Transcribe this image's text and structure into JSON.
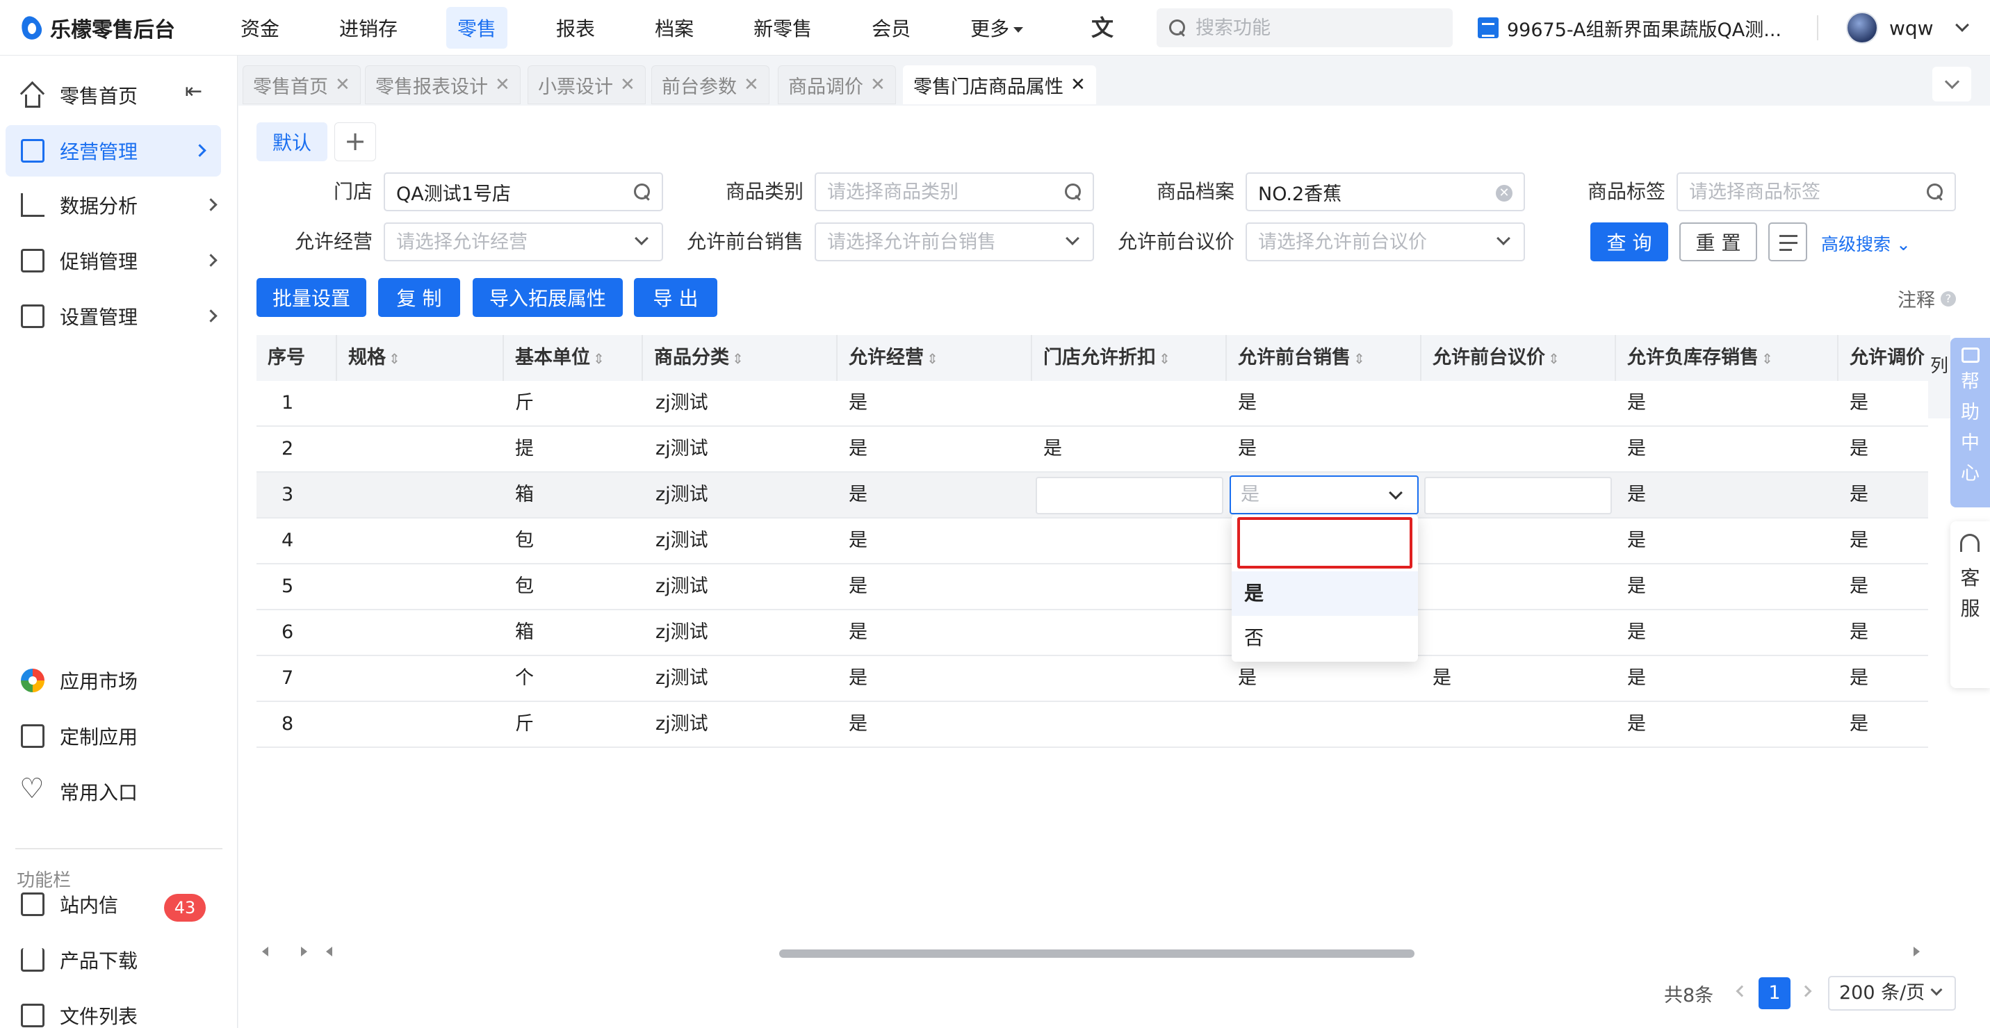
{
  "app": {
    "logo_text": "乐檬零售后台",
    "nav": [
      "资金",
      "进销存",
      "零售",
      "报表",
      "档案",
      "新零售",
      "会员"
    ],
    "nav_more": "更多",
    "search_placeholder": "搜索功能",
    "store_label": "99675-A组新界面果蔬版QA测...",
    "user_name": "wqw"
  },
  "sidebar": {
    "items": [
      "零售首页",
      "经营管理",
      "数据分析",
      "促销管理",
      "设置管理"
    ],
    "bottom_items": [
      "应用市场",
      "定制应用",
      "常用入口"
    ],
    "section_label": "功能栏",
    "tools": [
      "站内信",
      "产品下载",
      "文件列表"
    ],
    "message_count": "43"
  },
  "tabs": [
    "零售首页",
    "零售报表设计",
    "小票设计",
    "前台参数",
    "商品调价",
    "零售门店商品属性"
  ],
  "scheme": {
    "default_label": "默认",
    "add_label": "+"
  },
  "filters": {
    "store_label": "门店",
    "store_value": "QA测试1号店",
    "category_label": "商品类别",
    "category_placeholder": "请选择商品类别",
    "archive_label": "商品档案",
    "archive_value": "NO.2香蕉",
    "tag_label": "商品标签",
    "tag_placeholder": "请选择商品标签",
    "allow_manage_label": "允许经营",
    "allow_manage_placeholder": "请选择允许经营",
    "allow_pos_sale_label": "允许前台销售",
    "allow_pos_sale_placeholder": "请选择允许前台销售",
    "allow_pos_bargain_label": "允许前台议价",
    "allow_pos_bargain_placeholder": "请选择允许前台议价",
    "query_button": "查 询",
    "reset_button": "重 置",
    "advanced_search": "高级搜索"
  },
  "actions": {
    "batch_set": "批量设置",
    "copy": "复 制",
    "import_ext": "导入拓展属性",
    "export": "导 出",
    "note": "注释"
  },
  "table": {
    "columns": [
      "序号",
      "规格",
      "基本单位",
      "商品分类",
      "允许经营",
      "门店允许折扣",
      "允许前台销售",
      "允许前台议价",
      "允许负库存销售",
      "允许调价"
    ],
    "column_setting": "列",
    "rows": [
      {
        "no": "1",
        "spec": "",
        "unit": "斤",
        "category": "zj测试",
        "allow_manage": "是",
        "store_discount": "",
        "pos_sale": "是",
        "pos_bargain": "",
        "neg_stock": "是",
        "price_adjust": "是"
      },
      {
        "no": "2",
        "spec": "",
        "unit": "提",
        "category": "zj测试",
        "allow_manage": "是",
        "store_discount": "是",
        "pos_sale": "是",
        "pos_bargain": "",
        "neg_stock": "是",
        "price_adjust": "是"
      },
      {
        "no": "3",
        "spec": "",
        "unit": "箱",
        "category": "zj测试",
        "allow_manage": "是",
        "store_discount": "",
        "pos_sale": "是",
        "pos_bargain": "",
        "neg_stock": "是",
        "price_adjust": "是"
      },
      {
        "no": "4",
        "spec": "",
        "unit": "包",
        "category": "zj测试",
        "allow_manage": "是",
        "store_discount": "",
        "pos_sale": "",
        "pos_bargain": "",
        "neg_stock": "是",
        "price_adjust": "是"
      },
      {
        "no": "5",
        "spec": "",
        "unit": "包",
        "category": "zj测试",
        "allow_manage": "是",
        "store_discount": "",
        "pos_sale": "",
        "pos_bargain": "",
        "neg_stock": "是",
        "price_adjust": "是"
      },
      {
        "no": "6",
        "spec": "",
        "unit": "箱",
        "category": "zj测试",
        "allow_manage": "是",
        "store_discount": "",
        "pos_sale": "",
        "pos_bargain": "",
        "neg_stock": "是",
        "price_adjust": "是"
      },
      {
        "no": "7",
        "spec": "",
        "unit": "个",
        "category": "zj测试",
        "allow_manage": "是",
        "store_discount": "",
        "pos_sale": "是",
        "pos_bargain": "是",
        "neg_stock": "是",
        "price_adjust": "是"
      },
      {
        "no": "8",
        "spec": "",
        "unit": "斤",
        "category": "zj测试",
        "allow_manage": "是",
        "store_discount": "",
        "pos_sale": "",
        "pos_bargain": "",
        "neg_stock": "是",
        "price_adjust": "是"
      }
    ],
    "editing_select_value": "是"
  },
  "dropdown": {
    "options": [
      "是",
      "否"
    ],
    "selected": "是"
  },
  "pagination": {
    "total": "共8条",
    "current_page": "1",
    "page_size": "200 条/页"
  },
  "widgets": {
    "help_center": [
      "帮",
      "助",
      "中",
      "心"
    ],
    "customer_service": [
      "客",
      "服"
    ]
  }
}
